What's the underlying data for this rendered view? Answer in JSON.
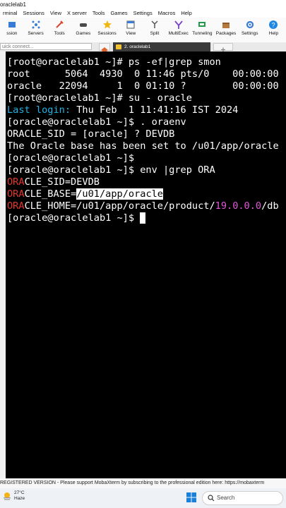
{
  "window": {
    "title": "oraclelab1"
  },
  "menu": [
    "rminal",
    "Sessions",
    "View",
    "X server",
    "Tools",
    "Games",
    "Settings",
    "Macros",
    "Help"
  ],
  "toolbar": [
    {
      "label": "ssion",
      "icon": "session-icon"
    },
    {
      "label": "Servers",
      "icon": "servers-icon"
    },
    {
      "label": "Tools",
      "icon": "tools-icon"
    },
    {
      "label": "Games",
      "icon": "games-icon"
    },
    {
      "label": "Sessions",
      "icon": "sessions-icon"
    },
    {
      "label": "View",
      "icon": "view-icon"
    },
    {
      "label": "Split",
      "icon": "split-icon"
    },
    {
      "label": "MultiExec",
      "icon": "multiexec-icon"
    },
    {
      "label": "Tunneling",
      "icon": "tunneling-icon"
    },
    {
      "label": "Packages",
      "icon": "packages-icon"
    },
    {
      "label": "Settings",
      "icon": "settings-icon"
    },
    {
      "label": "Help",
      "icon": "help-icon"
    }
  ],
  "tabs": {
    "quick_connect_placeholder": "uick connect...",
    "session_tab": "2. oraclelab1"
  },
  "terminal": {
    "lines": [
      {
        "segments": [
          {
            "t": "[root@oraclelab1 ~]# ps -ef|grep smon",
            "c": "#ffffff"
          }
        ]
      },
      {
        "segments": [
          {
            "t": "root      5064  4930  0 11:46 pts/0    00:00:00",
            "c": "#ffffff"
          }
        ]
      },
      {
        "segments": [
          {
            "t": "oracle   22094     1  0 01:10 ?        00:00:00",
            "c": "#ffffff"
          }
        ]
      },
      {
        "segments": [
          {
            "t": "[root@oraclelab1 ~]# su - oracle",
            "c": "#ffffff"
          }
        ]
      },
      {
        "segments": [
          {
            "t": "Last login:",
            "c": "#1fb3e6"
          },
          {
            "t": " Thu Feb  1 11:41:16 IST 2024",
            "c": "#ffffff"
          }
        ]
      },
      {
        "segments": [
          {
            "t": "[oracle@oraclelab1 ~]$ . oraenv",
            "c": "#ffffff"
          }
        ]
      },
      {
        "segments": [
          {
            "t": "ORACLE_SID = [oracle] ? DEVDB",
            "c": "#ffffff"
          }
        ]
      },
      {
        "segments": [
          {
            "t": "The Oracle base has been set to /u01/app/oracle",
            "c": "#ffffff"
          }
        ]
      },
      {
        "segments": [
          {
            "t": "[oracle@oraclelab1 ~]$",
            "c": "#ffffff"
          }
        ]
      },
      {
        "segments": [
          {
            "t": "[oracle@oraclelab1 ~]$ env |grep ORA",
            "c": "#ffffff"
          }
        ]
      },
      {
        "segments": [
          {
            "t": "ORA",
            "c": "#e0362f"
          },
          {
            "t": "CLE_SID=DEVDB",
            "c": "#ffffff"
          }
        ]
      },
      {
        "segments": [
          {
            "t": "ORA",
            "c": "#e0362f"
          },
          {
            "t": "CLE_BASE=",
            "c": "#ffffff"
          },
          {
            "t": "/u01/app/oracle",
            "c": "#000000",
            "hl": true
          }
        ]
      },
      {
        "segments": [
          {
            "t": "ORA",
            "c": "#e0362f"
          },
          {
            "t": "CLE_HOME=/u01/app/oracle/product/",
            "c": "#ffffff"
          },
          {
            "t": "19.0.0.0",
            "c": "#e056d8"
          },
          {
            "t": "/db",
            "c": "#ffffff"
          }
        ]
      },
      {
        "segments": [
          {
            "t": "[oracle@oraclelab1 ~]$ ",
            "c": "#ffffff"
          },
          {
            "t": " ",
            "c": "#000000",
            "hl": true
          }
        ]
      }
    ]
  },
  "status": {
    "text": "REGISTERED VERSION  -  Please support MobaXterm by subscribing to the professional edition here:  https://mobaxterm"
  },
  "taskbar": {
    "temp": "27°C",
    "weather": "Haze",
    "search": "Search"
  }
}
